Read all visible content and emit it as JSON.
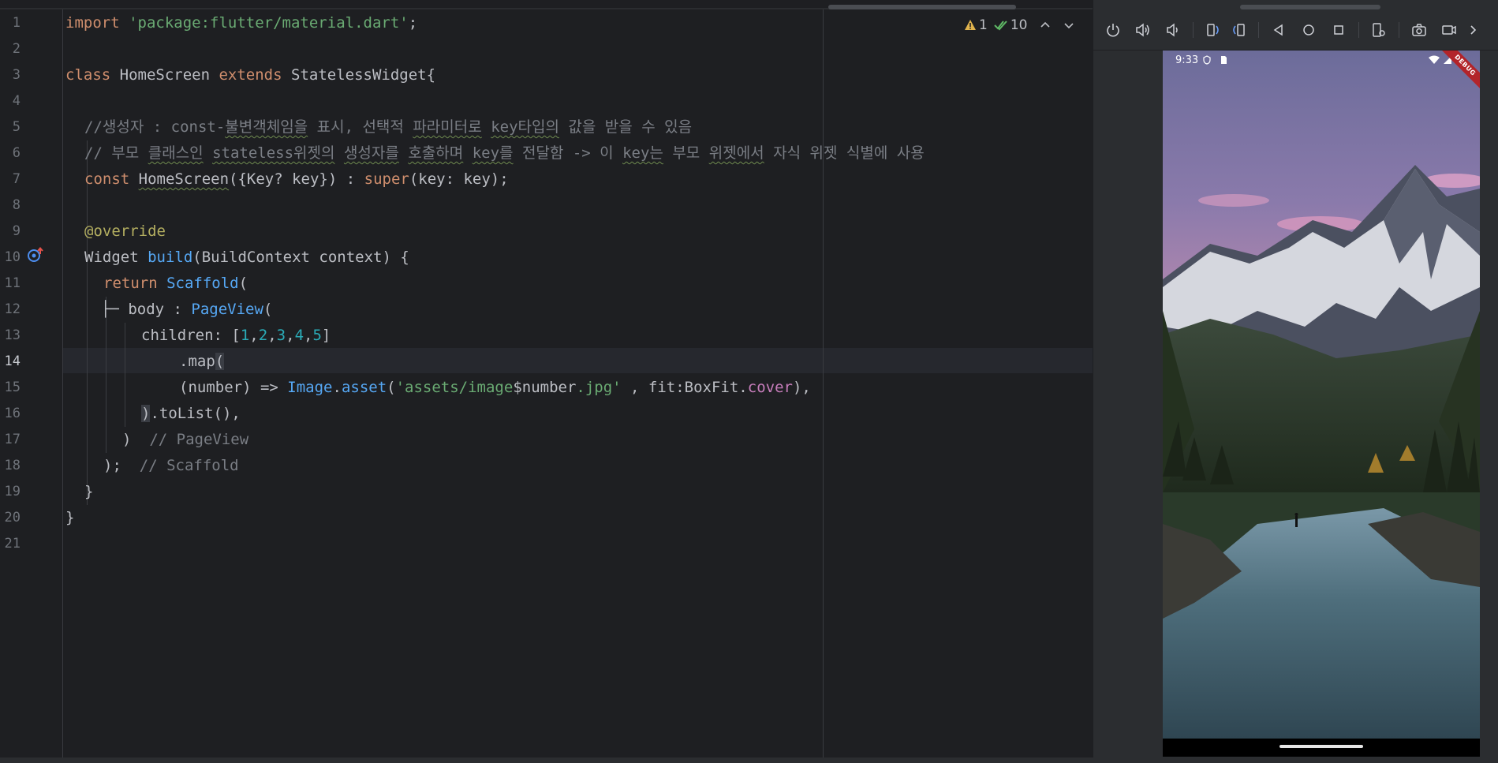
{
  "editor": {
    "current_line": 14,
    "line_numbers": [
      "1",
      "2",
      "3",
      "4",
      "5",
      "6",
      "7",
      "8",
      "9",
      "10",
      "11",
      "12",
      "13",
      "14",
      "15",
      "16",
      "17",
      "18",
      "19",
      "20",
      "21"
    ],
    "inspection": {
      "warnings": "1",
      "checks": "10"
    },
    "code": {
      "l1_kw": "import",
      "l1_str": "'package:flutter/material.dart'",
      "l1_end": ";",
      "l3_kw": "class",
      "l3_name": " HomeScreen ",
      "l3_kw2": "extends",
      "l3_rest": " StatelessWidget{",
      "l5_a": "//생성자 : const-",
      "l5_b": "불변객체임을",
      "l5_c": " 표시, 선택적 ",
      "l5_d": "파라미터로",
      "l5_e": " ",
      "l5_f": "key타입의",
      "l5_g": " 값을 받을 수 있음",
      "l6_a": "// 부모 ",
      "l6_b": "클래스인",
      "l6_c": " ",
      "l6_d": "stateless위젯의",
      "l6_e": " ",
      "l6_f": "생성자를",
      "l6_g": " ",
      "l6_h": "호출하며",
      "l6_i": " ",
      "l6_j": "key를",
      "l6_k": " 전달함 -> 이 ",
      "l6_l": "key는",
      "l6_m": " 부모 ",
      "l6_n": "위젯에서",
      "l6_o": " 자식 위젯 식별에 사용",
      "l7_kw": "const",
      "l7_sp": " ",
      "l7_name": "HomeScreen",
      "l7_mid": "({Key? key}) : ",
      "l7_super": "super",
      "l7_end": "(key: key);",
      "l9_ann": "@override",
      "l10_a": "Widget ",
      "l10_fn": "build",
      "l10_b": "(BuildContext context) {",
      "l11_kw": "return",
      "l11_sp": " ",
      "l11_cls": "Scaffold",
      "l11_end": "(",
      "l12_tree": "├─",
      "l12_a": " body : ",
      "l12_cls": "PageView",
      "l12_end": "(",
      "l13_a": "children: [",
      "l13_n1": "1",
      "l13_n2": "2",
      "l13_n3": "3",
      "l13_n4": "4",
      "l13_n5": "5",
      "l13_comma": ",",
      "l13_end": "]",
      "l14_a": ".map",
      "l14_paren": "(",
      "l15_a": "(number) => ",
      "l15_cls": "Image",
      "l15_dot": ".",
      "l15_fn": "asset",
      "l15_p": "(",
      "l15_str1": "'assets/image",
      "l15_var": "$number",
      "l15_str2": ".jpg'",
      "l15_mid": " , fit:BoxFit.",
      "l15_prop": "cover",
      "l15_end": "),",
      "l16_paren": ")",
      "l16_a": ".toList(),",
      "l17_a": ")",
      "l17_cmt": "  // PageView",
      "l18_a": ");",
      "l18_cmt": "  // Scaffold",
      "l19_a": "}",
      "l20_a": "}"
    }
  },
  "emulator": {
    "status_time": "9:33",
    "debug_banner": "DEBUG",
    "toolbar": [
      "power-icon",
      "volume-up-icon",
      "volume-down-icon",
      "rotate-left-icon",
      "rotate-right-icon",
      "back-icon",
      "home-icon",
      "overview-icon",
      "settings-icon",
      "camera-icon",
      "record-icon",
      "more-icon"
    ],
    "scene_colors": {
      "sky_top": "#7a6d9c",
      "sky_pink": "#c992b4",
      "forest": "#2d3a2a",
      "river": "#5d7d8c"
    }
  }
}
